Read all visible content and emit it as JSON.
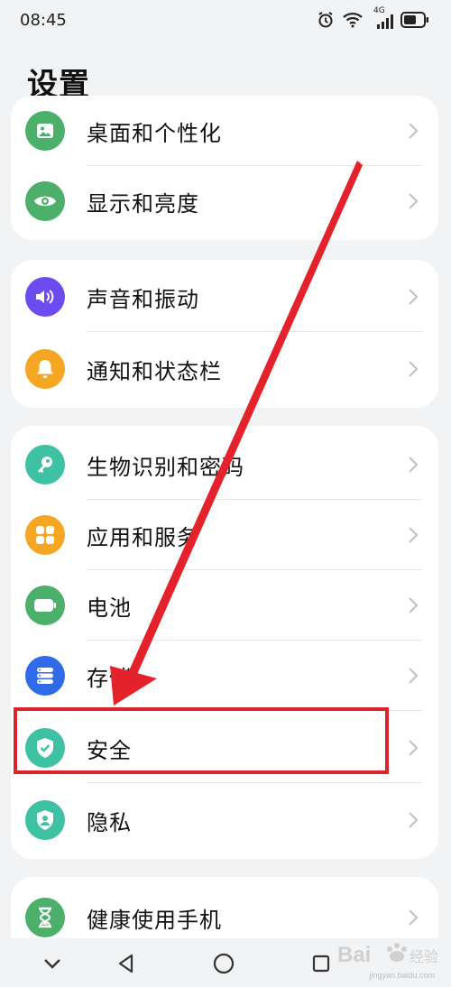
{
  "status_bar": {
    "time": "08:45",
    "network": "4G",
    "icons": [
      "alarm-icon",
      "wifi-icon",
      "signal-icon",
      "battery-icon"
    ]
  },
  "page": {
    "title": "设置"
  },
  "groups": [
    {
      "items": [
        {
          "label": "桌面和个性化",
          "icon": "image-icon",
          "color": "#4caf6a"
        },
        {
          "label": "显示和亮度",
          "icon": "eye-icon",
          "color": "#4caf6a"
        }
      ]
    },
    {
      "items": [
        {
          "label": "声音和振动",
          "icon": "speaker-icon",
          "color": "#6c4cf0"
        },
        {
          "label": "通知和状态栏",
          "icon": "bell-icon",
          "color": "#f5a623"
        }
      ]
    },
    {
      "items": [
        {
          "label": "生物识别和密码",
          "icon": "key-icon",
          "color": "#3fc2a4"
        },
        {
          "label": "应用和服务",
          "icon": "apps-grid-icon",
          "color": "#f5a623"
        },
        {
          "label": "电池",
          "icon": "battery-icon",
          "color": "#4caf6a"
        },
        {
          "label": "存储",
          "icon": "storage-icon",
          "color": "#2f6be8"
        },
        {
          "label": "安全",
          "icon": "shield-check-icon",
          "color": "#3fc2a4"
        },
        {
          "label": "隐私",
          "icon": "privacy-user-icon",
          "color": "#3fc2a4"
        }
      ]
    },
    {
      "items": [
        {
          "label": "健康使用手机",
          "icon": "hourglass-icon",
          "color": "#4caf6a"
        }
      ]
    }
  ],
  "annotation": {
    "highlight_color": "#d9232d"
  },
  "watermark": {
    "text": "Bai",
    "text2": "经验",
    "sub": "jingyan.baidu.com"
  }
}
